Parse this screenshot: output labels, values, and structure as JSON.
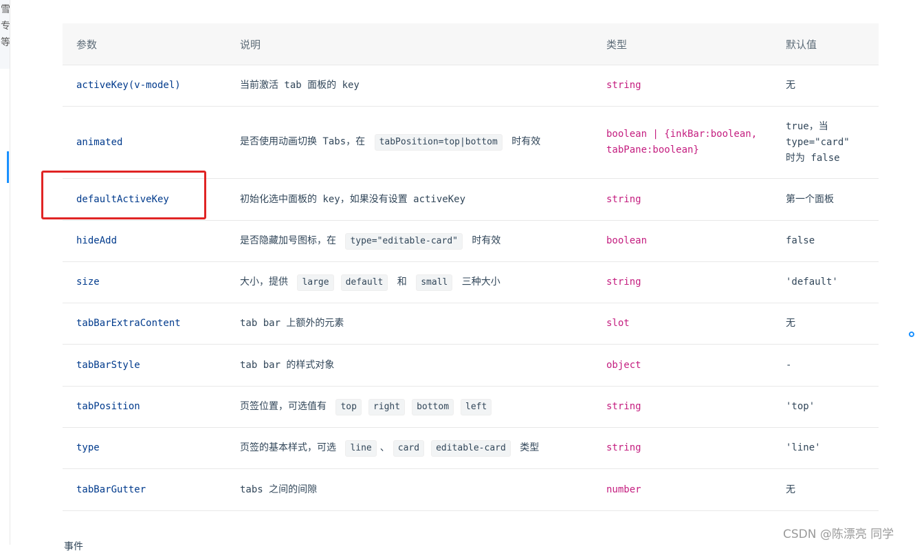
{
  "side": {
    "chars": [
      "雪",
      "专",
      "等"
    ]
  },
  "table": {
    "headers": [
      "参数",
      "说明",
      "类型",
      "默认值"
    ],
    "rows": [
      {
        "param": "activeKey(v-model)",
        "desc": [
          "当前激活 tab 面板的 key"
        ],
        "type": "string",
        "default": "无"
      },
      {
        "param": "animated",
        "desc": [
          "是否使用动画切换 Tabs，在 ",
          {
            "code": "tabPosition=top|bottom"
          },
          " 时有效"
        ],
        "type": "boolean | {inkBar:boolean, tabPane:boolean}",
        "default": "true，当 type=\"card\" 时为 false"
      },
      {
        "param": "defaultActiveKey",
        "desc": [
          "初始化选中面板的 key，如果没有设置 activeKey"
        ],
        "type": "string",
        "default": "第一个面板"
      },
      {
        "param": "hideAdd",
        "desc": [
          "是否隐藏加号图标，在 ",
          {
            "code": "type=\"editable-card\""
          },
          " 时有效"
        ],
        "type": "boolean",
        "default": "false"
      },
      {
        "param": "size",
        "desc": [
          "大小，提供 ",
          {
            "code": "large"
          },
          {
            "code": "default"
          },
          " 和 ",
          {
            "code": "small"
          },
          " 三种大小"
        ],
        "type": "string",
        "default": "'default'"
      },
      {
        "param": "tabBarExtraContent",
        "desc": [
          "tab bar 上额外的元素"
        ],
        "type": "slot",
        "default": "无"
      },
      {
        "param": "tabBarStyle",
        "desc": [
          "tab bar 的样式对象"
        ],
        "type": "object",
        "default": "-"
      },
      {
        "param": "tabPosition",
        "desc": [
          "页签位置，可选值有 ",
          {
            "code": "top"
          },
          {
            "code": "right"
          },
          {
            "code": "bottom"
          },
          {
            "code": "left"
          }
        ],
        "type": "string",
        "default": "'top'"
      },
      {
        "param": "type",
        "desc": [
          "页签的基本样式，可选 ",
          {
            "code": "line"
          },
          "、",
          {
            "code": "card"
          },
          {
            "code": "editable-card"
          },
          " 类型"
        ],
        "type": "string",
        "default": "'line'"
      },
      {
        "param": "tabBarGutter",
        "desc": [
          "tabs 之间的间隙"
        ],
        "type": "number",
        "default": "无"
      }
    ],
    "row_heights": [
      60,
      105,
      61,
      60,
      60,
      60,
      61,
      60,
      60,
      61
    ]
  },
  "annotation": {
    "highlighted_row": "defaultActiveKey",
    "color": "#e02424"
  },
  "watermark": "CSDN @陈漂亮 同学",
  "bottom_fragment": "事件",
  "colors": {
    "param": "#003a8c",
    "type": "#c41d7f",
    "text": "#314659",
    "header_bg": "#f7f7f7",
    "accent": "#1890ff"
  }
}
